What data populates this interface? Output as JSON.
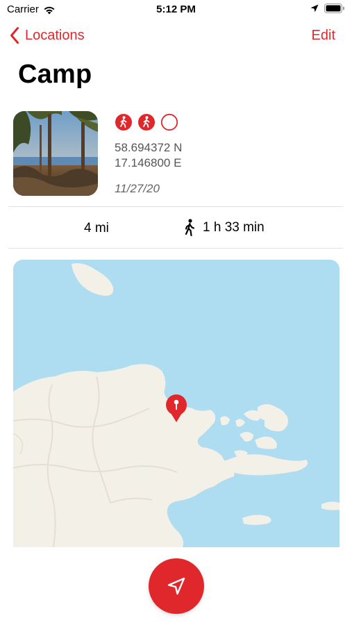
{
  "status_bar": {
    "carrier": "Carrier",
    "time": "5:12 PM",
    "icons": [
      "wifi-icon",
      "location-arrow-icon",
      "battery-icon"
    ]
  },
  "nav": {
    "back_label": "Locations",
    "edit_label": "Edit"
  },
  "location": {
    "title": "Camp",
    "latitude": "58.694372 N",
    "longitude": "17.146800 E",
    "date": "11/27/20",
    "activities": [
      {
        "icon": "hiking-icon",
        "filled": true
      },
      {
        "icon": "hiking-icon",
        "filled": true
      },
      {
        "icon": "empty-circle-icon",
        "filled": false
      }
    ]
  },
  "stats": {
    "distance": "4 mi",
    "walk_time": "1 h 33 min"
  },
  "map": {
    "water_color": "#aedcf1",
    "land_color": "#f3f0e8",
    "pin_color": "#e0272b"
  },
  "colors": {
    "accent": "#e0272b"
  }
}
